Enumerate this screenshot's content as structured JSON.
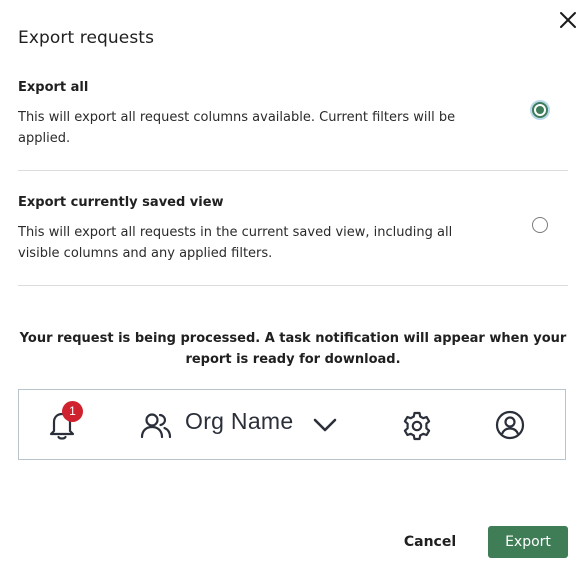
{
  "dialog": {
    "title": "Export requests",
    "close_icon": "close-icon"
  },
  "options": [
    {
      "title": "Export all",
      "description": "This will export all request columns available. Current filters will be applied.",
      "selected": true
    },
    {
      "title": "Export currently saved view",
      "description": "This will export all requests in the current saved view, including all visible columns and any applied filters.",
      "selected": false
    }
  ],
  "processing_message": "Your request is being processed. A task notification will appear when your report is ready for download.",
  "preview_bar": {
    "notification_count": "1",
    "org_name": "Org Name",
    "icons": [
      "bell-icon",
      "users-icon",
      "chevron-down-icon",
      "gear-icon",
      "profile-icon"
    ]
  },
  "footer": {
    "cancel_label": "Cancel",
    "export_label": "Export"
  },
  "colors": {
    "primary": "#3f7d57",
    "badge": "#d0222e",
    "radio_focus": "#b9d9ea",
    "preview_border": "#b8c4cc"
  }
}
